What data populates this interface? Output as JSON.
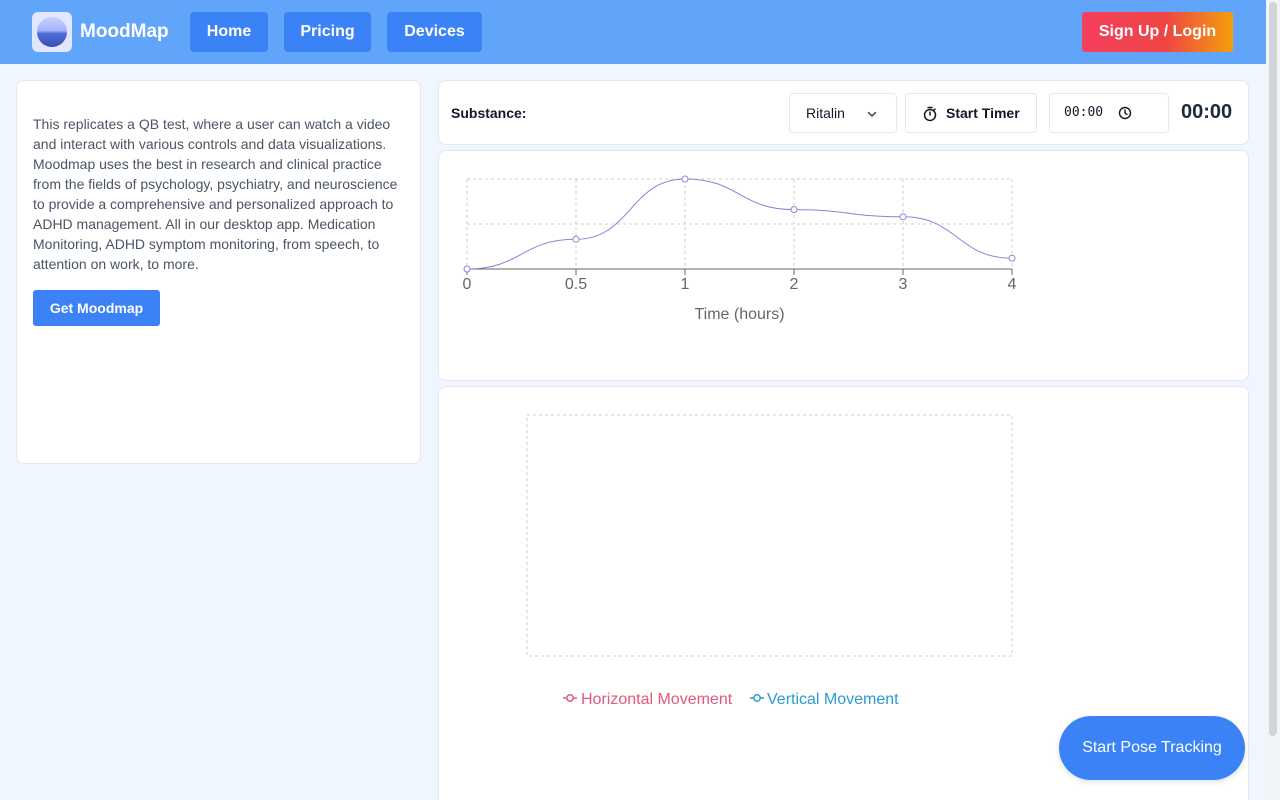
{
  "header": {
    "brand": "MoodMap",
    "nav": {
      "home": "Home",
      "pricing": "Pricing",
      "devices": "Devices"
    },
    "auth_label": "Sign Up / Login"
  },
  "info": {
    "description": "This replicates a QB test, where a user can watch a video and interact with various controls and data visualizations. Moodmap uses the best in research and clinical practice from the fields of psychology, psychiatry, and neuroscience to provide a comprehensive and personalized approach to ADHD management. All in our desktop app. Medication Monitoring, ADHD symptom monitoring, from speech, to attention on work, to more.",
    "cta_label": "Get Moodmap"
  },
  "controls": {
    "substance_label": "Substance:",
    "substance_value": "Ritalin",
    "start_timer_label": "Start Timer",
    "time_input_value": "00:00",
    "time_display": "00:00"
  },
  "chart_data": [
    {
      "type": "line",
      "categories": [
        "0",
        "0.5",
        "1",
        "2",
        "3",
        "4"
      ],
      "values": [
        0,
        0.33,
        1.0,
        0.66,
        0.58,
        0.12
      ],
      "xlabel": "Time (hours)",
      "ylabel": "",
      "ylim": [
        0,
        1
      ],
      "grid": true,
      "color": "#8884d8"
    },
    {
      "type": "line",
      "series": [
        {
          "name": "Horizontal Movement",
          "color": "#e05a7b",
          "values": []
        },
        {
          "name": "Vertical Movement",
          "color": "#2b9bd0",
          "values": []
        }
      ],
      "grid": true,
      "legend": "bottom"
    }
  ],
  "pose": {
    "button_label": "Start Pose Tracking"
  },
  "colors": {
    "header": "#60a5fa",
    "primary": "#3b82f6",
    "background": "#eff6ff"
  }
}
